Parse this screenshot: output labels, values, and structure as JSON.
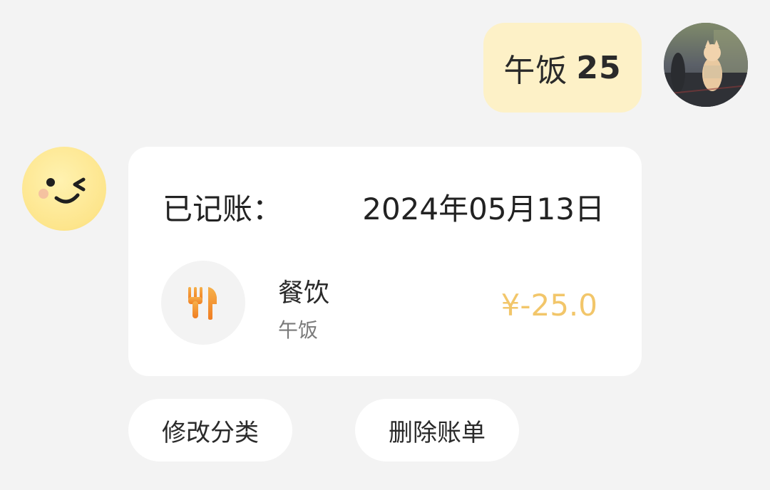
{
  "user_message": {
    "text": "午饭",
    "amount": "25"
  },
  "user_avatar": {
    "icon": "cat-photo-avatar"
  },
  "bot_avatar": {
    "icon": "wink-face-icon"
  },
  "record_card": {
    "title": "已记账：",
    "date": "2024年05月13日",
    "category": {
      "icon": "fork-knife-icon",
      "icon_color": "#f59a2e",
      "name": "餐饮",
      "note": "午饭"
    },
    "amount": "¥-25.0",
    "amount_color": "#f2c66a"
  },
  "actions": {
    "edit_label": "修改分类",
    "delete_label": "删除账单"
  }
}
